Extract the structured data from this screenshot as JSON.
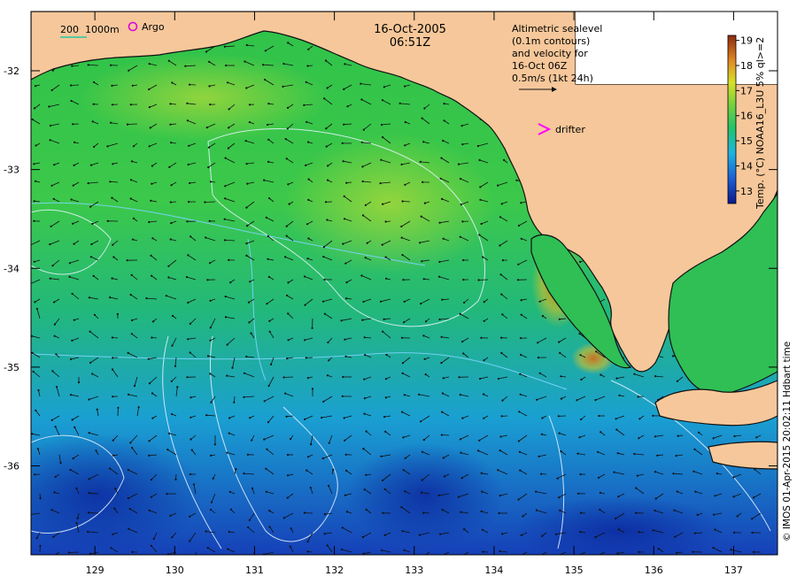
{
  "map": {
    "date": "16-Oct-2005",
    "time": "06:51Z",
    "lon_ticks": [
      129,
      130,
      131,
      132,
      133,
      134,
      135,
      136,
      137
    ],
    "lat_ticks": [
      -32,
      -33,
      -34,
      -35,
      -36
    ],
    "lon_range": [
      128.2,
      137.55
    ],
    "lat_range": [
      -36.9,
      -31.4
    ],
    "scale_bar_label": "200  1000m",
    "argo_label": "Argo",
    "drifter_label": "drifter",
    "altimetry_lines": [
      "Altimetric sealevel",
      "(0.1m contours)",
      "and velocity for",
      "16-Oct 06Z",
      "0.5m/s (1kt 24h)"
    ],
    "colorbar": {
      "title": "Temp. (°C) NOAA16_L3U 5% ql>=2",
      "min": 12.5,
      "max": 19.2,
      "ticks": [
        13,
        14,
        15,
        16,
        17,
        18,
        19
      ]
    },
    "credit": "© IMOS 01-Apr-2015 20:02:11 Hdbart time",
    "colors": {
      "land": "#f6c79a",
      "cold": "#0a1a8c",
      "warm": "#c0401c",
      "argo": "#dd00dd",
      "drifter": "#ff00ff",
      "scale_bar": "#23c8a0"
    }
  }
}
